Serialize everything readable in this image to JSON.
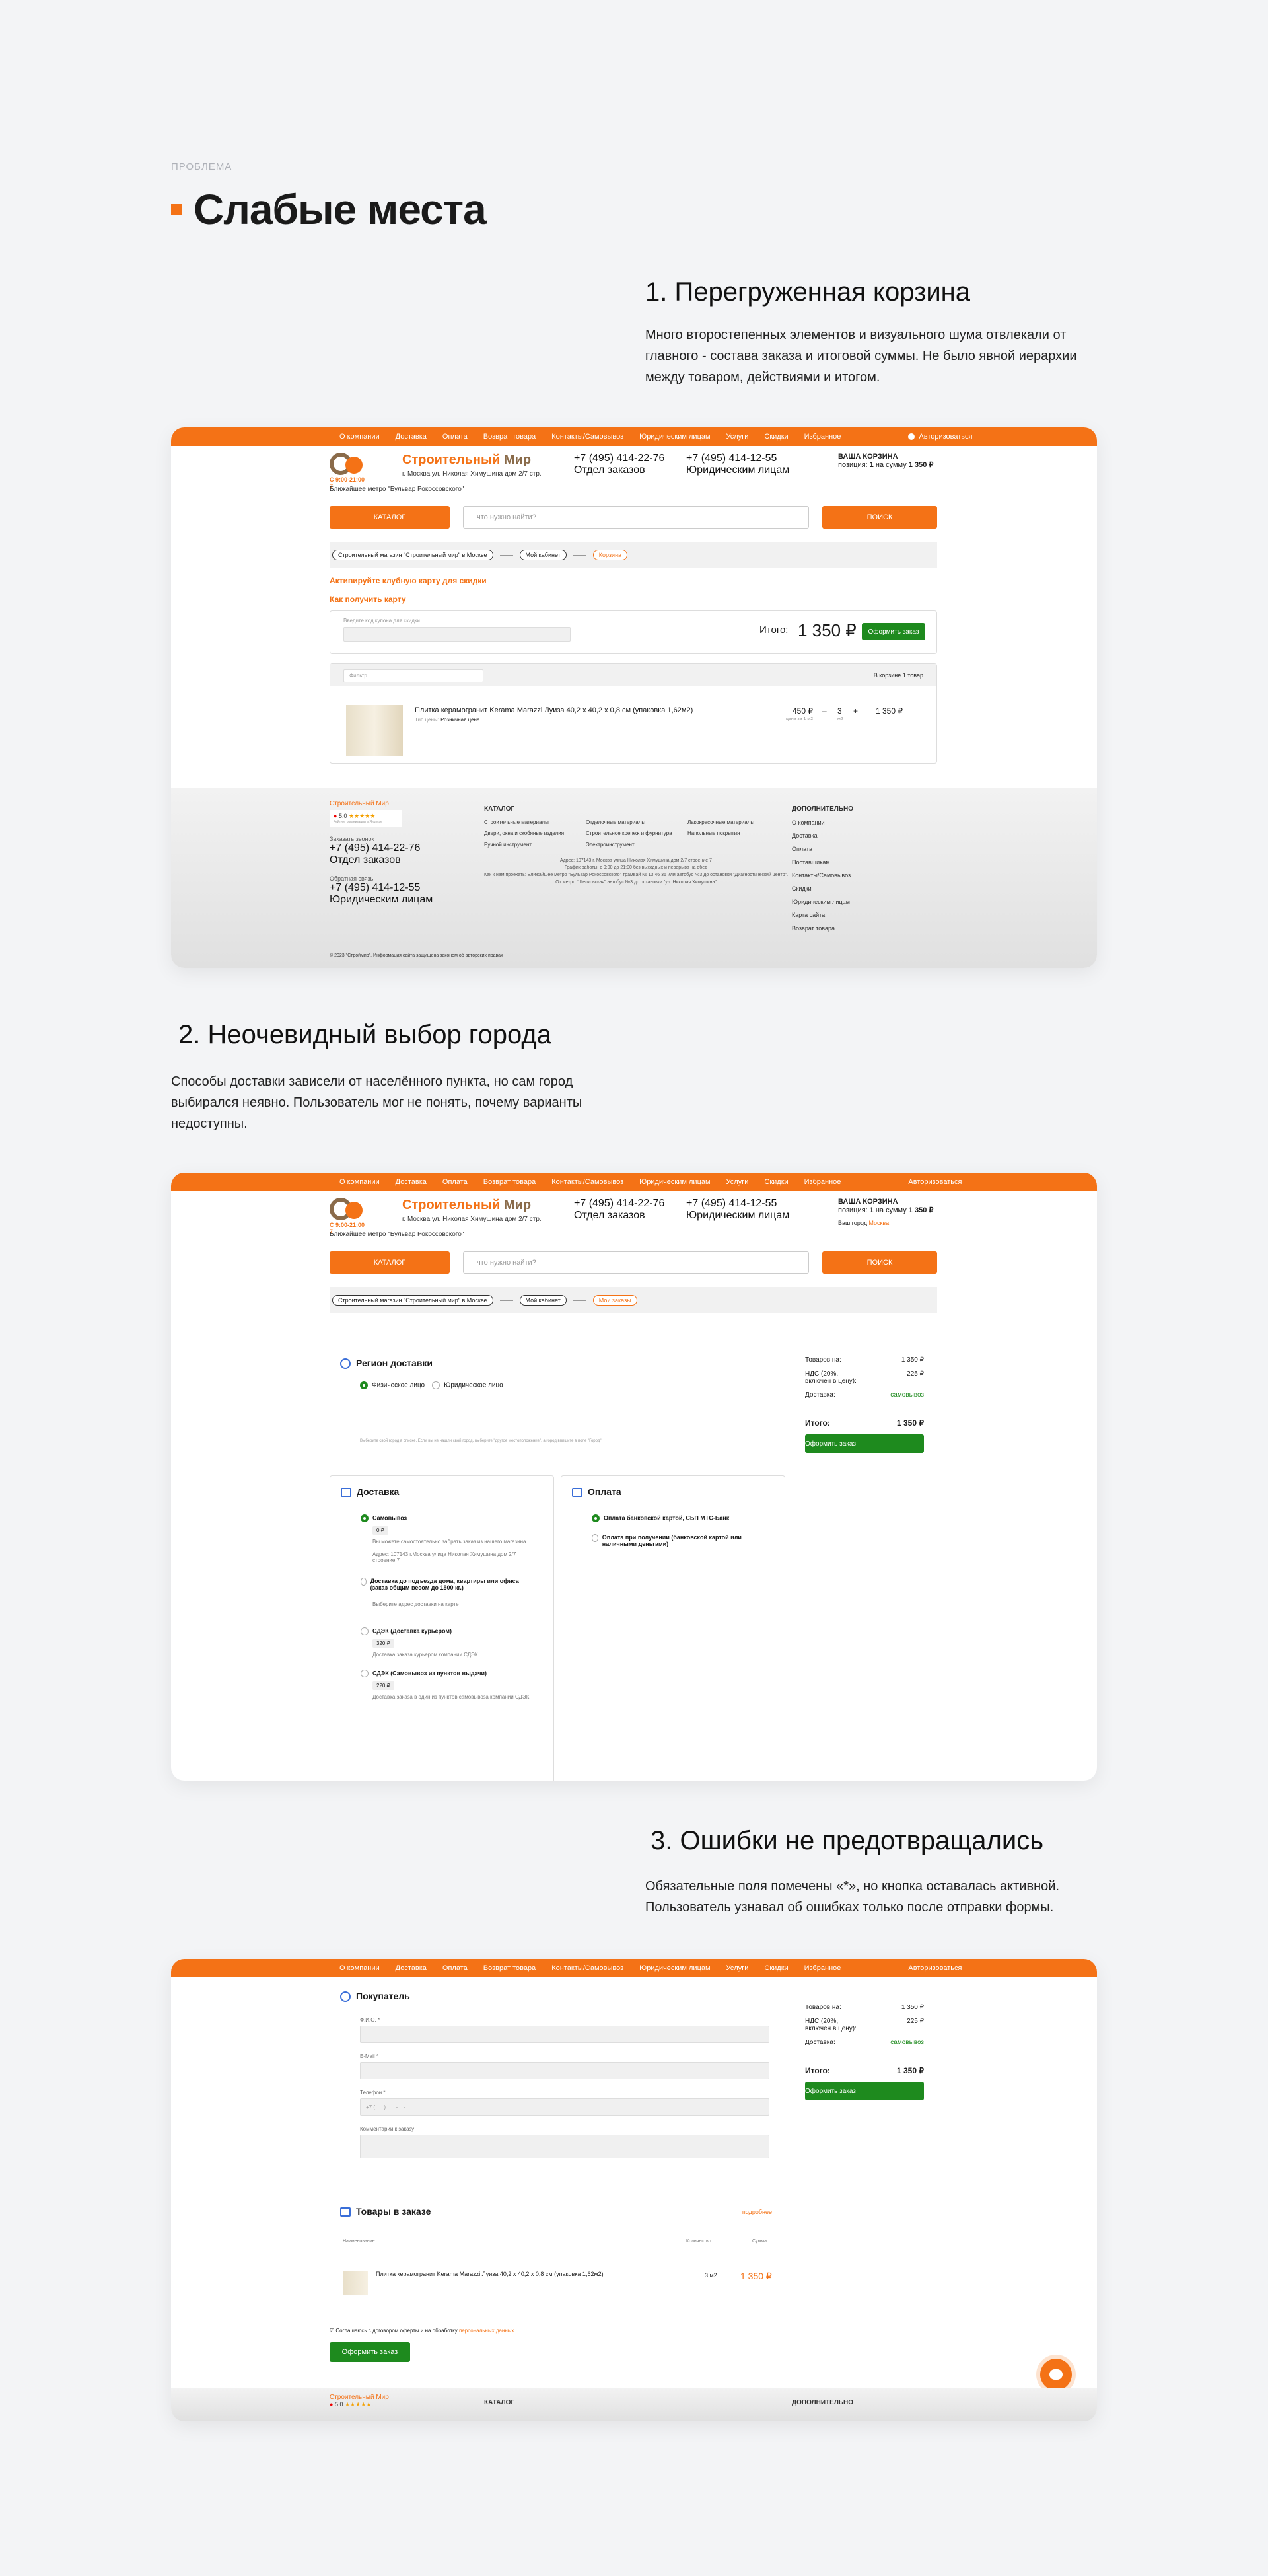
{
  "section_label": "ПРОБЛЕМА",
  "title": "Слабые места",
  "p1": {
    "heading": "1. Перегруженная корзина",
    "text": "Много второстепенных элементов и визуального шума отвлекали от главного - состава заказа и итоговой суммы. Не было явной иерархии между товаром, действиями и итогом."
  },
  "p2": {
    "heading": "2. Неочевидный выбор города",
    "text": "Способы доставки зависели от населённого пункта, но сам город выбирался неявно. Пользователь мог не понять, почему варианты недоступны."
  },
  "p3": {
    "heading": "3. Ошибки не предотвращались",
    "text": "Обязательные поля помечены «*», но кнопка оставалась активной. Пользователь узнавал об ошибках только после отправки формы."
  },
  "nav": {
    "items": [
      "О компании",
      "Доставка",
      "Оплата",
      "Возврат товара",
      "Контакты/Самовывоз",
      "Юридическим лицам",
      "Услуги",
      "Скидки",
      "Избранное"
    ],
    "login": "Авторизоваться"
  },
  "header": {
    "brand_a": "Строительный",
    "brand_b": "Мир",
    "hours": "С 9:00-21:00",
    "hours2": "7",
    "address": "г. Москва ул. Николая Химушина дом 2/7 стр.",
    "metro": "Ближайшее метро \"Бульвар Рокоссовского\"",
    "phone1": "+7 (495) 414-22-76",
    "phone1_sub": "Отдел заказов",
    "phone2": "+7 (495) 414-12-55",
    "phone2_sub": "Юридическим лицам",
    "cart_title": "ВАШ КОРЗИНА",
    "cart_line_a": "позиция: ",
    "cart_line_b": "1",
    "cart_line_c": " на сумму ",
    "cart_line_d": "1 350 ₽",
    "cart_title_b": "ВАША КОРЗИНА",
    "city_label": "Ваш город ",
    "city_value": "Москва"
  },
  "bar": {
    "catalog": "КАТАЛОГ",
    "search_placeholder": "что нужно найти?",
    "search_btn": "ПОИСК"
  },
  "crumbs1": [
    "Строительный магазин \"Строительный мир\" в Москве",
    "Мой кабинет",
    "Корзина"
  ],
  "crumbs2": [
    "Строительный магазин \"Строительный мир\" в Москве",
    "Мой кабинет",
    "Мои заказы"
  ],
  "cart": {
    "club": "Активируйте клубную карту для скидки",
    "how": "Как получить карту",
    "card_label": "Введите код купона для скидки",
    "total_label": "Итого:",
    "total": "1 350 ₽",
    "checkout": "Оформить заказ",
    "filter": "Фильтр",
    "in_cart": "В корзине 1 товар",
    "item": "Плитка керамогранит Kerama Marazzi Луиза 40,2 х 40,2 х 0,8 см (упаковка 1,62м2)",
    "price_type_a": "Тип цены: ",
    "price_type_b": "Розничная цена",
    "unit_price": "450 ₽",
    "unit_note": "цена за 1 м2",
    "qty": "3",
    "qty_unit": "м2",
    "sum": "1 350 ₽"
  },
  "footer": {
    "brand": "Строительный Мир",
    "rating": "5.0",
    "rating_note": "Рейтинг организации в Яндексе",
    "call_label": "Заказать звонок",
    "phone1": "+7 (495) 414-22-76",
    "phone1_sub": "Отдел заказов",
    "fb_label": "Обратная связь",
    "phone2": "+7 (495) 414-12-55",
    "phone2_sub": "Юридическим лицам",
    "catalog": "КАТАЛОГ",
    "cat_items": [
      "Строительные материалы",
      "Отделочные материалы",
      "Лакокрасочные материалы",
      "Двери, окна и скобяные изделия",
      "Строительное крепеж и фурнитура",
      "Напольные покрытия",
      "Ручной инструмент",
      "Электроинструмент"
    ],
    "addr1": "Адрес: 107143 г. Москва улица Николая Химушина дом 2/7 строение 7",
    "addr2": "График работы: с 9:00 до 21:00 без выходных и перерыва на обед",
    "addr3": "Как к нам проехать: Ближайшее метро \"Бульвар Рокоссовского\" трамвай № 13 46 36 или автобус №3 до остановки \"Диагностический центр\". От метро \"Щелковская\" автобус №3 до остановки \"ул. Николая Химушина\"",
    "extra": "ДОПОЛНИТЕЛЬНО",
    "extra_items": [
      "О компании",
      "Доставка",
      "Оплата",
      "Поставщикам",
      "Контакты/Самовывоз",
      "Скидки",
      "Юридическим лицам",
      "Карта сайта",
      "Возврат товара"
    ],
    "copyright": "© 2023 \"Строймир\". Информация сайта защищена законом об авторских правах"
  },
  "order": {
    "region_title": "Регион доставки",
    "person1": "Физическое лицо",
    "person2": "Юридическое лицо",
    "region_hint": "Выберите свой город в списке. Если вы не нашли свой город, выберите \"другое местоположение\", а город впишите в поле \"Город\"",
    "delivery_title": "Доставка",
    "payment_title": "Оплата",
    "d1": "Самовывоз",
    "d1_tag": "0 ₽",
    "d1_note": "Вы можете самостоятельно забрать заказ из нашего магазина",
    "d1_addr": "Адрес: 107143 г.Москва улица Николая Химушина дом 2/7 строение 7",
    "d2": "Доставка до подъезда дома, квартиры или офиса (заказ общим весом до 1500 кг.)",
    "d2_note": "Выберите адрес доставки на карте",
    "d3": "СДЭК (Доставка курьером)",
    "d3_tag": "320 ₽",
    "d3_note": "Доставка заказа курьером компании СДЭК",
    "d4": "СДЭК (Самовывоз из пунктов выдачи)",
    "d4_tag": "220 ₽",
    "d4_note": "Доставка заказа в один из пунктов самовывоза компании СДЭК",
    "pay1": "Оплата банковской картой, СБП МТС-Банк",
    "pay2": "Оплата при получении (банковской картой или наличными деньгами)",
    "s_goods": "Товаров на:",
    "s_goods_v": "1 350 ₽",
    "s_vat": "НДС (20%, включен в цену):",
    "s_vat_v": "225 ₽",
    "s_del": "Доставка:",
    "s_del_v": "самовывоз",
    "s_total": "Итого:",
    "s_total_v": "1 350 ₽",
    "s_btn": "Оформить заказ"
  },
  "buyer": {
    "title": "Покупатель",
    "fio": "Ф.И.О. *",
    "email": "E-Mail *",
    "phone": "Телефон *",
    "phone_val": "+7 (___) ___-__-__",
    "comment": "Комментарии к заказу",
    "goods_title": "Товары в заказе",
    "more": "подробнее",
    "col_name": "Наименование",
    "col_qty": "Количество",
    "col_sum": "Сумма",
    "item": "Плитка керамогранит Kerama Marazzi Луиза 40,2 х 40,2 х 0,8 см (упаковка 1,62м2)",
    "qty": "3 м2",
    "sum": "1 350 ₽",
    "agree_a": "Соглашаюсь с договором оферты и на обработку ",
    "agree_b": "персональных данных",
    "submit": "Оформить заказ"
  },
  "colors": {
    "accent": "#f47216",
    "green": "#1e8a1e",
    "blue": "#3a6ed8"
  }
}
